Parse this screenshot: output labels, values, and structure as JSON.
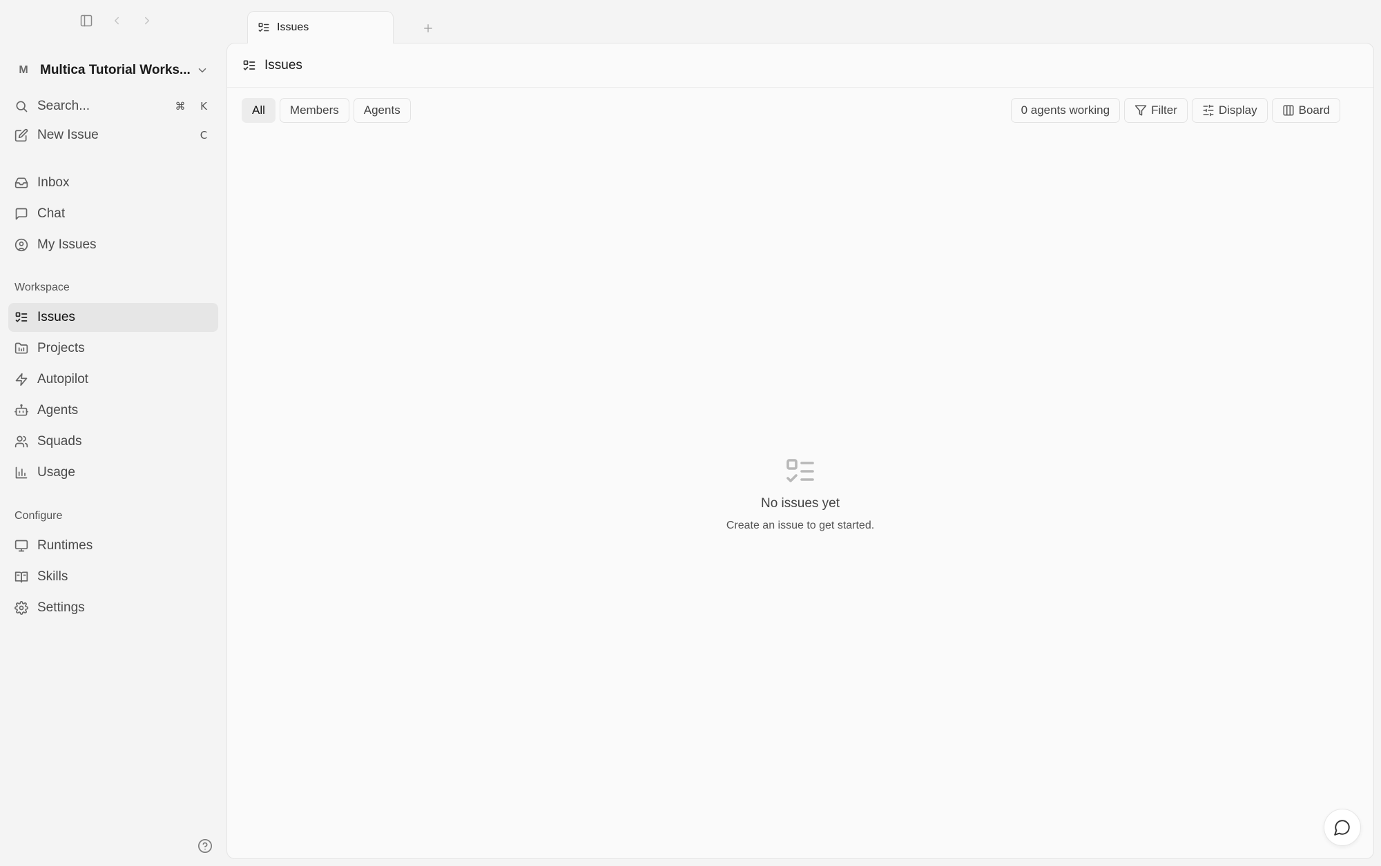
{
  "window": {
    "tabs": [
      {
        "label": "Issues",
        "icon": "list-check-icon",
        "active": true
      }
    ],
    "new_tab_label": "+"
  },
  "sidebar": {
    "workspace": {
      "initial": "M",
      "name": "Multica Tutorial Works..."
    },
    "search": {
      "label": "Search...",
      "shortcut_mod": "⌘",
      "shortcut_key": "K"
    },
    "new_issue": {
      "label": "New Issue",
      "shortcut_key": "C"
    },
    "personal": [
      {
        "label": "Inbox",
        "icon": "inbox-icon"
      },
      {
        "label": "Chat",
        "icon": "chat-icon"
      },
      {
        "label": "My Issues",
        "icon": "user-circle-icon"
      }
    ],
    "workspace_section": {
      "title": "Workspace",
      "items": [
        {
          "label": "Issues",
          "icon": "list-check-icon",
          "active": true
        },
        {
          "label": "Projects",
          "icon": "folder-icon"
        },
        {
          "label": "Autopilot",
          "icon": "lightning-icon"
        },
        {
          "label": "Agents",
          "icon": "bot-icon"
        },
        {
          "label": "Squads",
          "icon": "users-icon"
        },
        {
          "label": "Usage",
          "icon": "bar-chart-icon"
        }
      ]
    },
    "configure_section": {
      "title": "Configure",
      "items": [
        {
          "label": "Runtimes",
          "icon": "monitor-icon"
        },
        {
          "label": "Skills",
          "icon": "book-icon"
        },
        {
          "label": "Settings",
          "icon": "gear-icon"
        }
      ]
    }
  },
  "main": {
    "title": "Issues",
    "scopes": [
      {
        "label": "All",
        "active": true
      },
      {
        "label": "Members",
        "active": false
      },
      {
        "label": "Agents",
        "active": false
      }
    ],
    "agents_working": "0 agents working",
    "filter_label": "Filter",
    "display_label": "Display",
    "board_label": "Board",
    "empty": {
      "title": "No issues yet",
      "subtitle": "Create an issue to get started."
    }
  }
}
